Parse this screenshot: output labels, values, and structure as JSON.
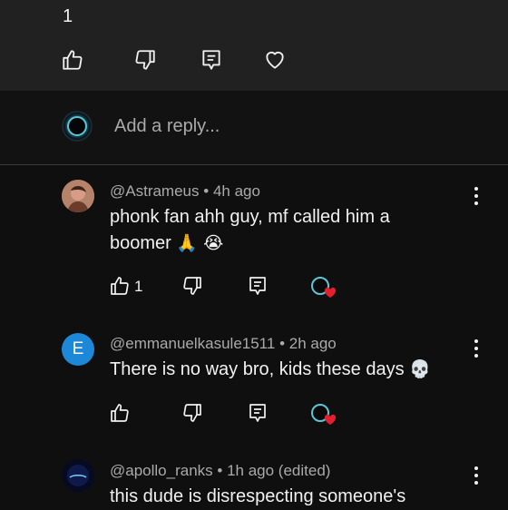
{
  "top_comment": {
    "like_count": "1"
  },
  "reply_box": {
    "placeholder": "Add a reply..."
  },
  "comments": [
    {
      "author": "@Astrameus",
      "time": "4h ago",
      "text_line1": "phonk fan ahh guy, mf called him a",
      "text_line2": "boomer",
      "emojis": "🙏 😭",
      "like_count": "1",
      "avatar_color": "#a0725a"
    },
    {
      "author": "@emmanuelkasule1511",
      "time": "2h ago",
      "text_line1": "There is no way bro, kids these days",
      "emojis": "💀",
      "avatar_letter": "E",
      "avatar_color": "#1e88d8"
    },
    {
      "author": "@apollo_ranks",
      "time": "1h ago (edited)",
      "text_line1": "this dude is disrespecting someone's",
      "avatar_color": "#0a1030"
    }
  ],
  "colors": {
    "background": "#0f0f0f",
    "top_panel": "#212121",
    "secondary_text": "#aaaaaa",
    "heart_red": "#e5202e",
    "ring_cyan": "#5bc7d6"
  }
}
